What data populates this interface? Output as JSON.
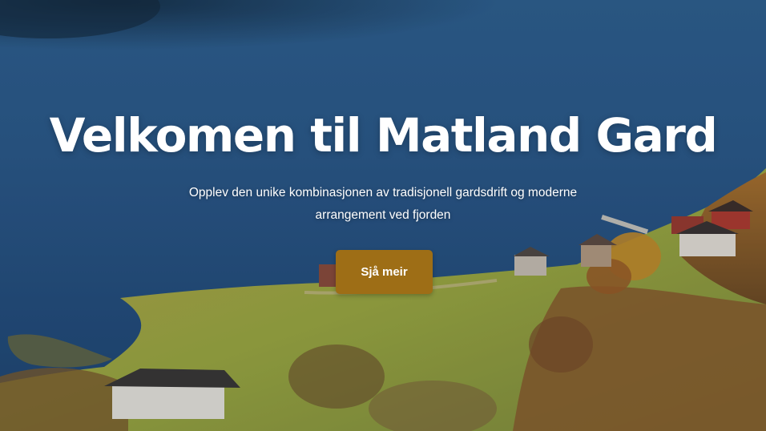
{
  "hero": {
    "title": "Velkomen til Matland Gard",
    "subtitle_line1": "Opplev den unike kombinasjonen av tradisjonell gardsdrift og moderne",
    "subtitle_line2": "arrangement ved fjorden",
    "cta_label": "Sjå meir"
  },
  "colors": {
    "cta_background": "#9e6e16",
    "title_text": "#ffffff",
    "fjord_water": "#2c5682"
  }
}
